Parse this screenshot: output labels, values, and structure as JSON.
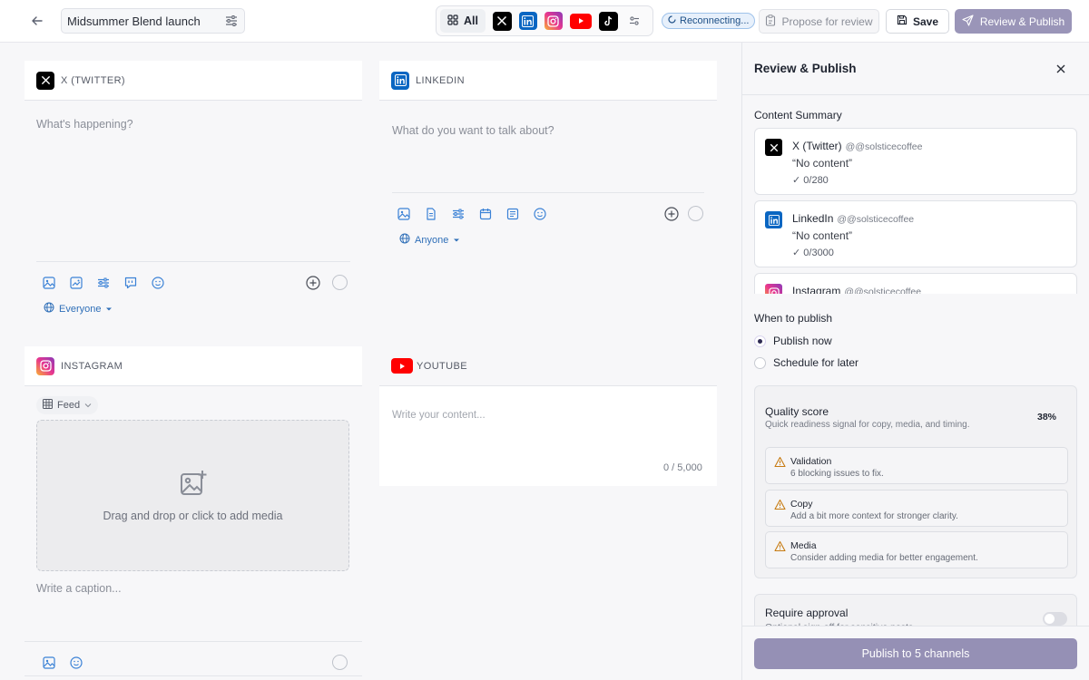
{
  "header": {
    "post_title": "Midsummer Blend launch",
    "all_label": "All",
    "status": "Reconnecting...",
    "propose_label": "Propose for review",
    "save_label": "Save",
    "review_label": "Review & Publish"
  },
  "editors": {
    "twitter": {
      "label": "X (TWITTER)",
      "placeholder": "What's happening?",
      "audience": "Everyone"
    },
    "linkedin": {
      "label": "LINKEDIN",
      "placeholder": "What do you want to talk about?",
      "audience": "Anyone"
    },
    "instagram": {
      "label": "INSTAGRAM",
      "format": "Feed",
      "dropzone": "Drag and drop or click to add media",
      "caption_placeholder": "Write a caption..."
    },
    "youtube": {
      "label": "YOUTUBE",
      "placeholder": "Write your content...",
      "counter": "0 / 5,000"
    }
  },
  "panel": {
    "title": "Review & Publish",
    "summary_title": "Content Summary",
    "summary": [
      {
        "name": "X (Twitter)",
        "handle": "@@solsticecoffee",
        "content": "“No content”",
        "count": "✓ 0/280"
      },
      {
        "name": "LinkedIn",
        "handle": "@@solsticecoffee",
        "content": "“No content”",
        "count": "✓ 0/3000"
      },
      {
        "name": "Instagram",
        "handle": "@@solsticecoffee"
      }
    ],
    "when_title": "When to publish",
    "options": [
      "Publish now",
      "Schedule for later"
    ],
    "selected_option": "Publish now",
    "quality": {
      "title": "Quality score",
      "subtitle": "Quick readiness signal for copy, media, and timing.",
      "percent": "38%",
      "items": [
        {
          "title": "Validation",
          "desc": "6 blocking issues to fix."
        },
        {
          "title": "Copy",
          "desc": "Add a bit more context for stronger clarity."
        },
        {
          "title": "Media",
          "desc": "Consider adding media for better engagement."
        }
      ]
    },
    "approval": {
      "title": "Require approval",
      "desc": "Optional sign-off for sensitive posts.",
      "enabled": false
    },
    "publish_label": "Publish to 5 channels"
  },
  "colors": {
    "accent": "#9590b5",
    "link": "#2f6fb8",
    "warning": "#c77b12",
    "linkedin": "#0a66c2",
    "youtube": "#ff0000"
  }
}
